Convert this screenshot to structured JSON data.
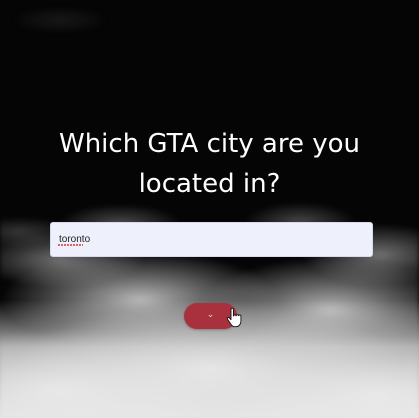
{
  "question": {
    "line1": "Which GTA city are you",
    "line2": "located in?"
  },
  "city_input": {
    "value": "toronto"
  },
  "submit": {
    "icon": "chevron-down-icon",
    "glyph": "⌄",
    "color": "#a9303d"
  },
  "cursor": {
    "icon": "hand-pointer-icon"
  },
  "colors": {
    "background": "#050505",
    "text": "#ffffff",
    "input_bg": "#eef0fb"
  }
}
